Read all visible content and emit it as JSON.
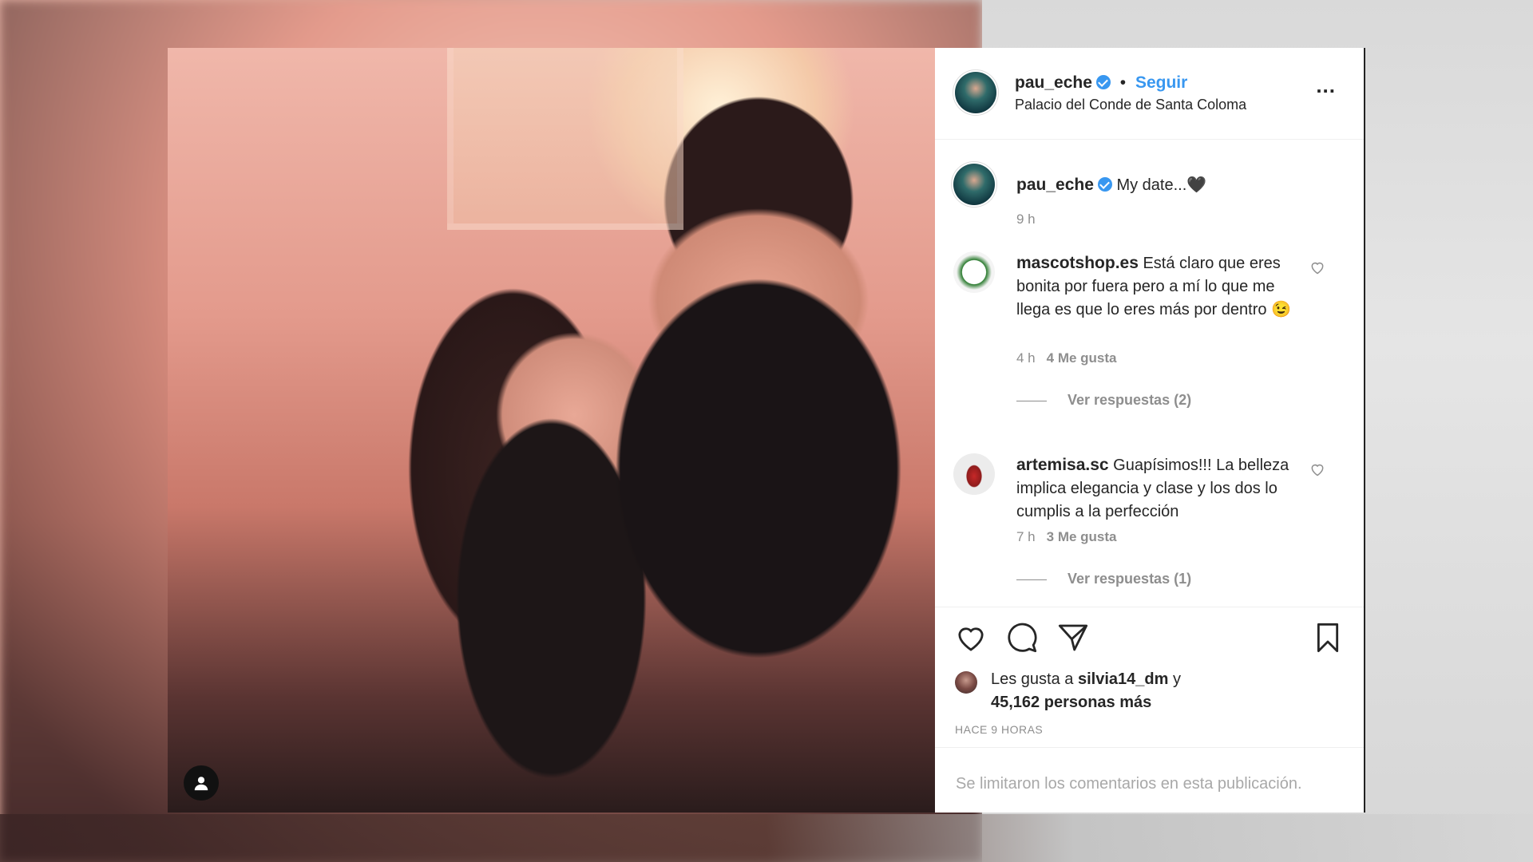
{
  "post": {
    "username": "pau_eche",
    "dot": "•",
    "follow_label": "Seguir",
    "location": "Palacio del Conde de Santa Coloma",
    "more_label": "..."
  },
  "caption": {
    "username": "pau_eche",
    "text": "My date...🖤",
    "time": "9 h"
  },
  "comments": [
    {
      "username": "mascotshop.es",
      "text": "Está claro que eres bonita por fuera pero a mí lo que me llega es que lo eres más por dentro 😉",
      "time": "4 h",
      "likes": "4 Me gusta",
      "replies": "Ver respuestas (2)"
    },
    {
      "username": "artemisa.sc",
      "text": "Guapísimos!!! La belleza implica elegancia y clase y los dos lo cumplis a la perfección",
      "time": "7 h",
      "likes": "3 Me gusta",
      "replies": "Ver respuestas (1)"
    }
  ],
  "likes": {
    "prefix": "Les gusta a",
    "user": "silvia14_dm",
    "conj": "y",
    "count": "45,162 personas más"
  },
  "timestamp": "HACE 9 HORAS",
  "comments_limited": "Se limitaron los comentarios en esta publicación.",
  "icons": {
    "like": "heart-icon",
    "comment": "comment-icon",
    "share": "paper-plane-icon",
    "save": "bookmark-icon",
    "user_tag": "user-icon"
  }
}
